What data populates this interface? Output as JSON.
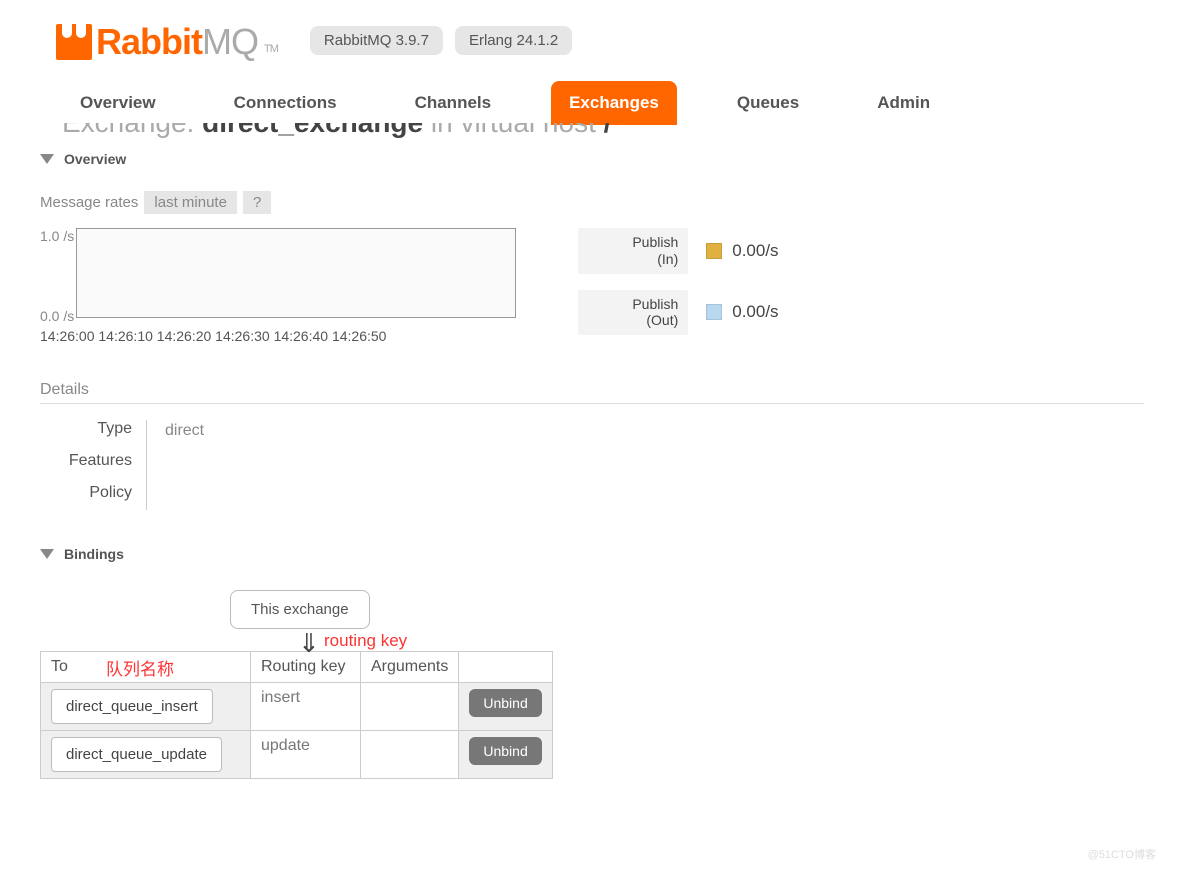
{
  "header": {
    "logo_rabbit": "Rabbit",
    "logo_mq": "MQ",
    "tm": "TM",
    "version_badge": "RabbitMQ 3.9.7",
    "erlang_badge": "Erlang 24.1.2"
  },
  "tabs": {
    "overview": "Overview",
    "connections": "Connections",
    "channels": "Channels",
    "exchanges": "Exchanges",
    "queues": "Queues",
    "admin": "Admin",
    "active": "exchanges"
  },
  "page_heading": {
    "prefix": "Exchange:",
    "name": "direct_exchange",
    "mid": "in virtual host",
    "vhost": "/"
  },
  "overview_section": {
    "title": "Overview",
    "rates_label": "Message rates",
    "rates_span": "last minute",
    "help": "?"
  },
  "chart_data": {
    "type": "line",
    "title": "",
    "xlabel": "",
    "ylabel": "",
    "ylim": [
      0,
      1.0
    ],
    "y_ticks": [
      "1.0 /s",
      "0.0 /s"
    ],
    "x_ticks": [
      "14:26:00",
      "14:26:10",
      "14:26:20",
      "14:26:30",
      "14:26:40",
      "14:26:50"
    ],
    "series": [
      {
        "name": "Publish (In)",
        "rate_text": "0.00/s",
        "color": "#e0b040"
      },
      {
        "name": "Publish (Out)",
        "rate_text": "0.00/s",
        "color": "#b8d8f0"
      }
    ]
  },
  "details": {
    "section": "Details",
    "labels": {
      "type": "Type",
      "features": "Features",
      "policy": "Policy"
    },
    "values": {
      "type": "direct",
      "features": "",
      "policy": ""
    }
  },
  "bindings": {
    "title": "Bindings",
    "this_exchange": "This exchange",
    "annotations": {
      "queue_name": "队列名称",
      "routing_key": "routing key"
    },
    "columns": {
      "to": "To",
      "routing_key": "Routing key",
      "arguments": "Arguments"
    },
    "unbind_label": "Unbind",
    "rows": [
      {
        "to": "direct_queue_insert",
        "routing_key": "insert",
        "arguments": ""
      },
      {
        "to": "direct_queue_update",
        "routing_key": "update",
        "arguments": ""
      }
    ]
  },
  "watermark": "@51CTO博客"
}
